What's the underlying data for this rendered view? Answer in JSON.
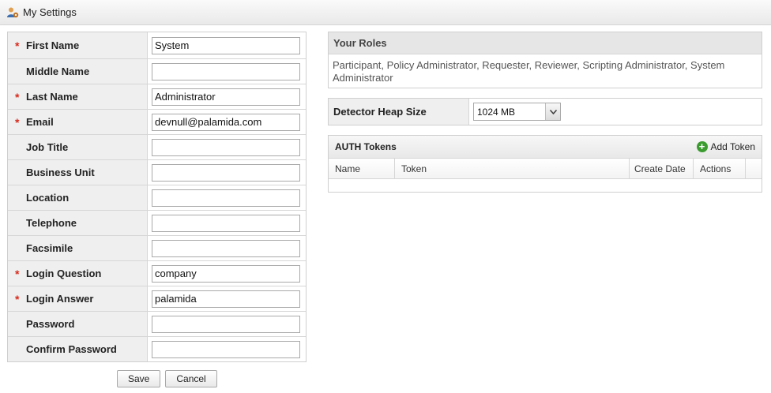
{
  "window": {
    "title": "My Settings",
    "icon": "user-settings-icon"
  },
  "form": {
    "fields": [
      {
        "label": "First Name",
        "required": true,
        "value": "System"
      },
      {
        "label": "Middle Name",
        "required": false,
        "value": ""
      },
      {
        "label": "Last Name",
        "required": true,
        "value": "Administrator"
      },
      {
        "label": "Email",
        "required": true,
        "value": "devnull@palamida.com"
      },
      {
        "label": "Job Title",
        "required": false,
        "value": ""
      },
      {
        "label": "Business Unit",
        "required": false,
        "value": ""
      },
      {
        "label": "Location",
        "required": false,
        "value": ""
      },
      {
        "label": "Telephone",
        "required": false,
        "value": ""
      },
      {
        "label": "Facsimile",
        "required": false,
        "value": ""
      },
      {
        "label": "Login Question",
        "required": true,
        "value": "company"
      },
      {
        "label": "Login Answer",
        "required": true,
        "value": "palamida"
      },
      {
        "label": "Password",
        "required": false,
        "value": ""
      },
      {
        "label": "Confirm Password",
        "required": false,
        "value": ""
      }
    ],
    "required_marker": "*",
    "save_label": "Save",
    "cancel_label": "Cancel"
  },
  "roles": {
    "header": "Your Roles",
    "text": "Participant, Policy Administrator, Requester, Reviewer, Scripting Administrator, System Administrator"
  },
  "heap": {
    "label": "Detector Heap Size",
    "selected": "1024 MB"
  },
  "tokens": {
    "title": "AUTH Tokens",
    "add_label": "Add Token",
    "columns": [
      "Name",
      "Token",
      "Create Date",
      "Actions"
    ]
  },
  "colors": {
    "required": "#d9291c",
    "add_icon": "#3a9c2f",
    "label_bg": "#efefef"
  }
}
